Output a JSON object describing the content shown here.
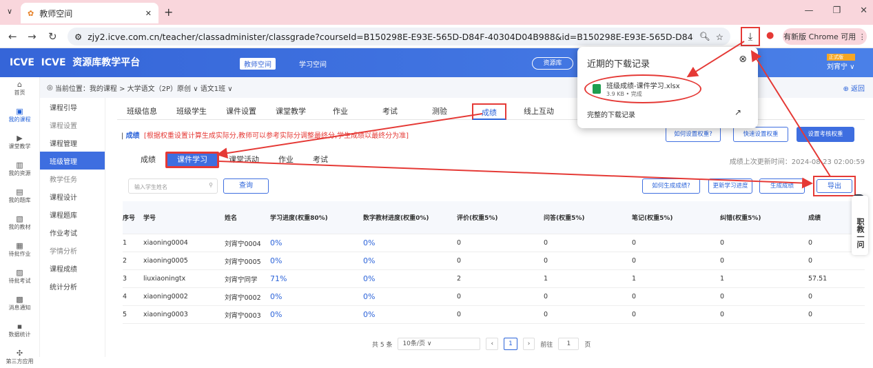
{
  "browser": {
    "tab_title": "教师空间",
    "url": "zjy2.icve.com.cn/teacher/classadminister/classgrade?courseId=B150298E-E93E-565D-D84F-40304D04B988&id=B150298E-E93E-565D-D84F-40304D892D89...",
    "update_label": "有新版 Chrome 可用"
  },
  "topbar": {
    "logo": "资源库教学平台",
    "teacher_space": "教师空间",
    "study_space": "学习空间",
    "resource_lib": "资源库",
    "user": "刘宵宁",
    "user_badge": "正式版"
  },
  "leftnav": [
    "首页",
    "我的课程",
    "课堂教学",
    "我的资源",
    "我的题库",
    "我的教材",
    "待批作业",
    "待批考试",
    "消息通知",
    "数据统计",
    "第三方应用"
  ],
  "breadcrumb": "当前位置：我的课程 > 大学语文（2P）原创 ∨ 语文1班 ∨",
  "back": "返回",
  "sidemenu": [
    {
      "label": "课程引导",
      "type": "item"
    },
    {
      "label": "课程设置",
      "type": "sec"
    },
    {
      "label": "课程管理",
      "type": "item"
    },
    {
      "label": "班级管理",
      "type": "on"
    },
    {
      "label": "教学任务",
      "type": "sec"
    },
    {
      "label": "课程设计",
      "type": "item"
    },
    {
      "label": "课程题库",
      "type": "item"
    },
    {
      "label": "作业考试",
      "type": "item"
    },
    {
      "label": "学情分析",
      "type": "sec"
    },
    {
      "label": "课程成绩",
      "type": "item"
    },
    {
      "label": "统计分析",
      "type": "item"
    }
  ],
  "tabs1": [
    "班级信息",
    "班级学生",
    "课件设置",
    "课堂教学",
    "作业",
    "考试",
    "测验",
    "成绩",
    "线上互动"
  ],
  "tip": {
    "title": "成绩",
    "text": "[根据权重设置计算生成实际分,教师可以参考实际分调整最终分,学生成绩以最终分为准]"
  },
  "tabs2": [
    "成绩",
    "课件学习",
    "课堂活动",
    "作业",
    "考试"
  ],
  "update_time": "成绩上次更新时间：2024-08-23 02:00:59",
  "search_placeholder": "输入学生姓名",
  "query": "查询",
  "buttons": {
    "how_weight": "如何设置权重?",
    "quick_weight": "快速设置权重",
    "exam_weight": "设置考核权重",
    "how_grade": "如何生成成绩?",
    "update_progress": "更新学习进度",
    "gen_grade": "生成成绩",
    "export": "导出"
  },
  "table": {
    "headers": [
      "序号",
      "学号",
      "姓名",
      "学习进度(权重80%)",
      "数字教材进度(权重0%)",
      "评价(权重5%)",
      "问答(权重5%)",
      "笔记(权重5%)",
      "纠错(权重5%)",
      "成绩"
    ],
    "rows": [
      [
        "1",
        "xiaoning0004",
        "刘宵宁0004",
        "0%",
        "0%",
        "0",
        "0",
        "0",
        "0",
        "0"
      ],
      [
        "2",
        "xiaoning0005",
        "刘宵宁0005",
        "0%",
        "0%",
        "0",
        "0",
        "0",
        "0",
        "0"
      ],
      [
        "3",
        "liuxiaoningtx",
        "刘宵宁同学",
        "71%",
        "0%",
        "2",
        "1",
        "1",
        "1",
        "57.51"
      ],
      [
        "4",
        "xiaoning0002",
        "刘宵宁0002",
        "0%",
        "0%",
        "0",
        "0",
        "0",
        "0",
        "0"
      ],
      [
        "5",
        "xiaoning0003",
        "刘宵宁0003",
        "0%",
        "0%",
        "0",
        "0",
        "0",
        "0",
        "0"
      ]
    ]
  },
  "pager": {
    "total": "共 5 条",
    "per_page": "10条/页",
    "page": "1",
    "goto": "前往",
    "goto_page": "1",
    "page_unit": "页"
  },
  "download": {
    "title": "近期的下载记录",
    "file": "班级成绩-课件学习.xlsx",
    "meta": "3.9 KB • 完成",
    "all": "完整的下载记录"
  },
  "floating": "职教一问"
}
